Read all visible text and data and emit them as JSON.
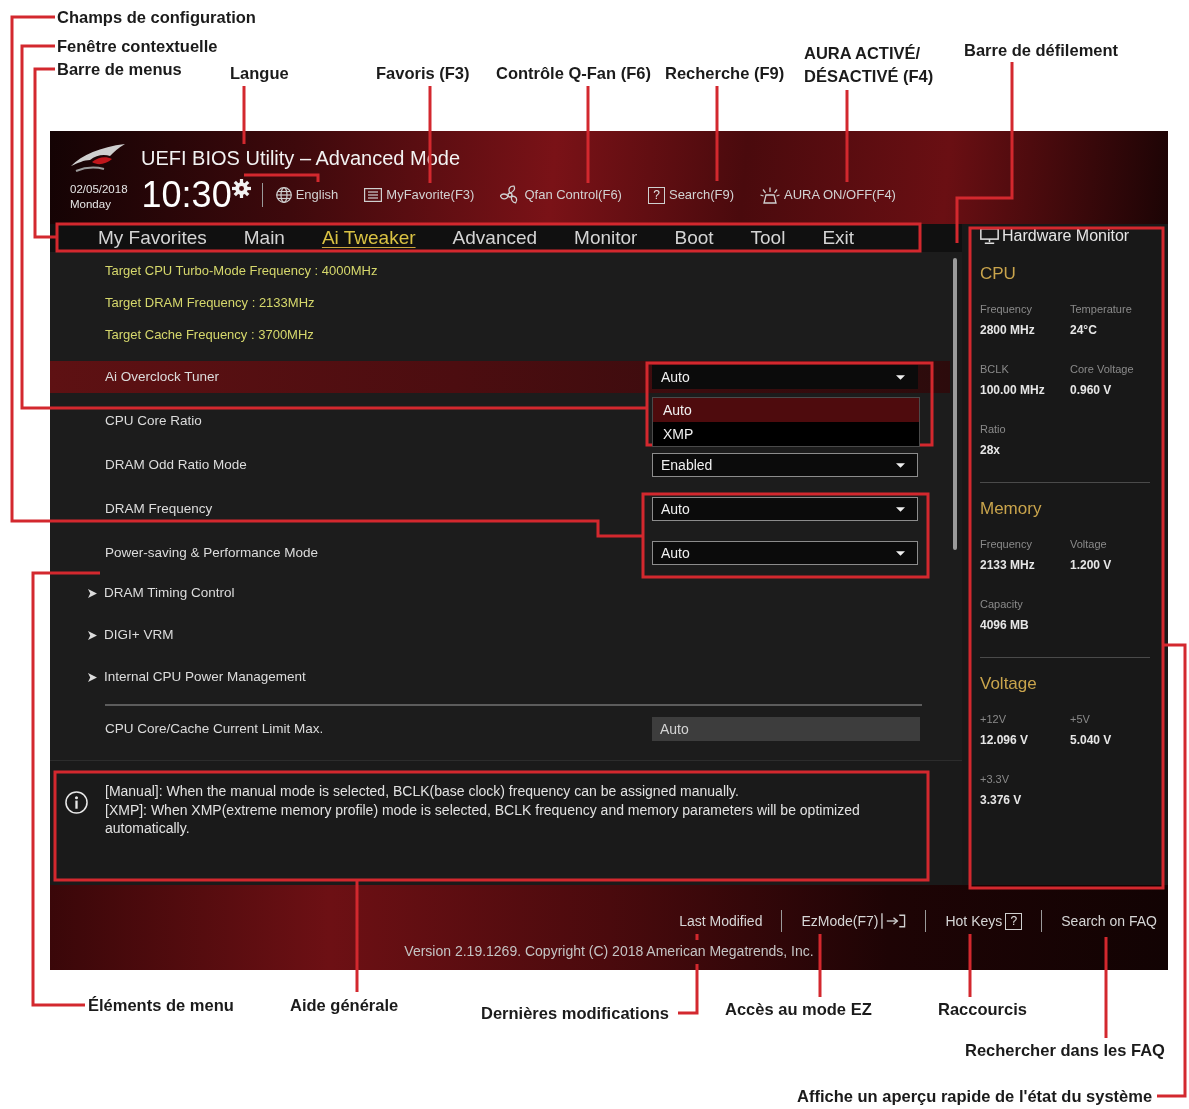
{
  "top_callouts": [
    {
      "label": "Champs de configuration"
    },
    {
      "label": "Fenêtre contextuelle"
    },
    {
      "label": "Barre de menus"
    },
    {
      "label": "Langue"
    },
    {
      "label": "Favoris (F3)"
    },
    {
      "label": "Contrôle Q-Fan (F6)"
    },
    {
      "label": "Recherche (F9)"
    },
    {
      "label": "AURA ACTIVÉ/ DÉSACTIVÉ (F4)"
    },
    {
      "label": "Barre de défilement"
    }
  ],
  "window": {
    "title": "UEFI BIOS Utility – Advanced Mode",
    "date": "02/05/2018",
    "day": "Monday",
    "time": "10:30"
  },
  "toolbar": [
    {
      "kind": "language",
      "label": "English"
    },
    {
      "kind": "favorites",
      "label": "MyFavorite(F3)"
    },
    {
      "kind": "fan",
      "label": "Qfan Control(F6)"
    },
    {
      "kind": "search",
      "key": "?",
      "label": "Search(F9)"
    },
    {
      "kind": "aura",
      "label": "AURA ON/OFF(F4)"
    }
  ],
  "tabs": [
    {
      "label": "My Favorites",
      "selected": false
    },
    {
      "label": "Main",
      "selected": false
    },
    {
      "label": "Ai Tweaker",
      "selected": true
    },
    {
      "label": "Advanced",
      "selected": false
    },
    {
      "label": "Monitor",
      "selected": false
    },
    {
      "label": "Boot",
      "selected": false
    },
    {
      "label": "Tool",
      "selected": false
    },
    {
      "label": "Exit",
      "selected": false
    }
  ],
  "settings": [
    {
      "kind": "info",
      "text": "Target CPU Turbo-Mode Frequency : 4000MHz"
    },
    {
      "kind": "info",
      "text": "Target DRAM Frequency : 2133MHz"
    },
    {
      "kind": "info",
      "text": "Target Cache Frequency : 3700MHz"
    },
    {
      "kind": "dropdown",
      "label": "Ai Overclock Tuner",
      "value": "Auto",
      "selected": true,
      "expanded": true,
      "options": [
        {
          "label": "Auto",
          "selected": true
        },
        {
          "label": "XMP",
          "selected": false
        }
      ]
    },
    {
      "kind": "plain",
      "label": "CPU Core Ratio",
      "selected": false
    },
    {
      "kind": "dropdown",
      "label": "DRAM Odd Ratio Mode",
      "value": "Enabled",
      "selected": false,
      "expanded": false
    },
    {
      "kind": "dropdown",
      "label": "DRAM Frequency",
      "value": "Auto",
      "selected": false,
      "expanded": false
    },
    {
      "kind": "dropdown",
      "label": "Power-saving & Performance Mode",
      "value": "Auto",
      "selected": false,
      "expanded": false
    },
    {
      "kind": "submenu",
      "label": "DRAM Timing Control",
      "selected": false
    },
    {
      "kind": "submenu",
      "label": "DIGI+ VRM",
      "selected": false
    },
    {
      "kind": "submenu",
      "label": "Internal CPU Power Management",
      "selected": false
    },
    {
      "kind": "separator"
    },
    {
      "kind": "field",
      "label": "CPU Core/Cache Current Limit Max.",
      "value": "Auto",
      "selected": false
    }
  ],
  "help": {
    "paragraphs": [
      "[Manual]: When the manual mode is selected, BCLK(base clock) frequency can be assigned manually.",
      "[XMP]: When XMP(extreme memory profile) mode is selected, BCLK frequency and memory parameters will be optimized automatically."
    ]
  },
  "hardware_monitor": {
    "title": "Hardware Monitor",
    "sections": [
      {
        "title": "CPU",
        "readings": [
          {
            "label": "Frequency",
            "value": "2800 MHz"
          },
          {
            "label": "Temperature",
            "value": "24°C"
          },
          {
            "label": "BCLK",
            "value": "100.00 MHz"
          },
          {
            "label": "Core Voltage",
            "value": "0.960 V"
          },
          {
            "label": "Ratio",
            "value": "28x"
          }
        ]
      },
      {
        "title": "Memory",
        "readings": [
          {
            "label": "Frequency",
            "value": "2133 MHz"
          },
          {
            "label": "Voltage",
            "value": "1.200 V"
          },
          {
            "label": "Capacity",
            "value": "4096 MB"
          }
        ]
      },
      {
        "title": "Voltage",
        "readings": [
          {
            "label": "+12V",
            "value": "12.096 V"
          },
          {
            "label": "+5V",
            "value": "5.040 V"
          },
          {
            "label": "+3.3V",
            "value": "3.376 V"
          }
        ]
      }
    ]
  },
  "footer": {
    "links": [
      {
        "kind": "text",
        "label": "Last Modified"
      },
      {
        "kind": "ezmode",
        "label": "EzMode(F7)"
      },
      {
        "kind": "hotkeys",
        "label": "Hot Keys",
        "key": "?"
      },
      {
        "kind": "text",
        "label": "Search on FAQ"
      }
    ],
    "version": "Version 2.19.1269. Copyright (C) 2018 American Megatrends, Inc."
  },
  "bottom_callouts": [
    {
      "label": "Éléments de menu"
    },
    {
      "label": "Aide générale"
    },
    {
      "label": "Dernières modifications"
    },
    {
      "label": "Accès au mode EZ"
    },
    {
      "label": "Raccourcis"
    },
    {
      "label": "Rechercher dans les FAQ"
    },
    {
      "label": "Affiche un aperçu rapide de l'état du système"
    }
  ]
}
